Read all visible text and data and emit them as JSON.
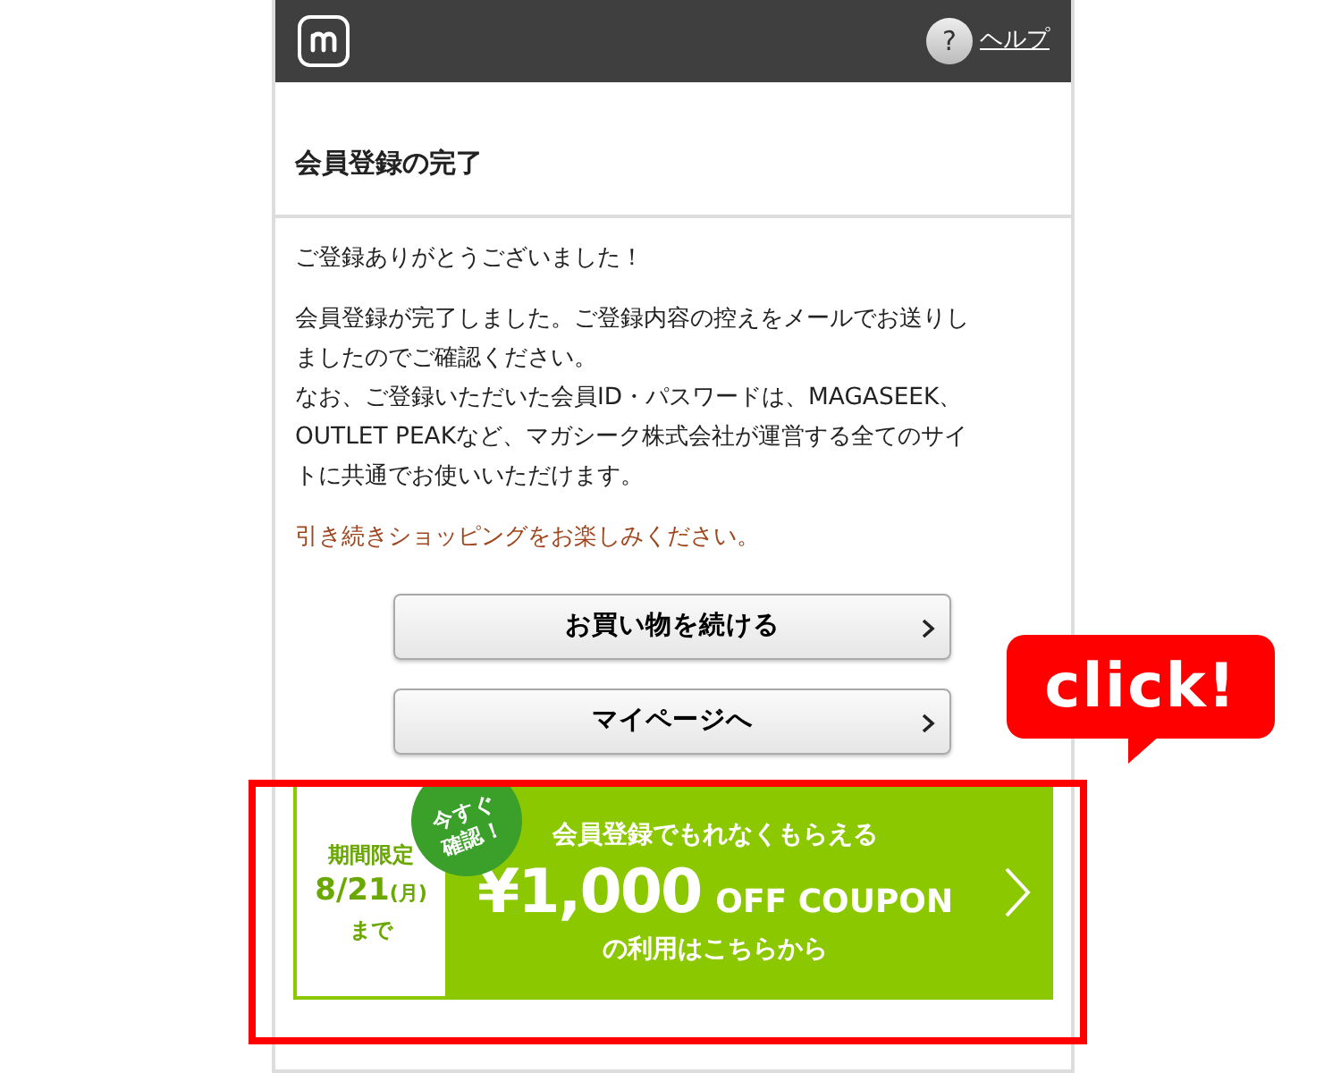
{
  "header": {
    "help_mark": "?",
    "help_label": "ヘルプ"
  },
  "title": "会員登録の完了",
  "thanks": "ご登録ありがとうございました！",
  "message_lines": [
    "会員登録が完了しました。ご登録内容の控えをメールでお送りし",
    "ましたのでご確認ください。",
    "なお、ご登録いただいた会員ID・パスワードは、MAGASEEK、",
    "OUTLET PEAKなど、マガシーク株式会社が運営する全てのサイ",
    "トに共通でお使いいただけます。"
  ],
  "note": "引き続きショッピングをお楽しみください。",
  "buttons": [
    {
      "label": "お買い物を続ける"
    },
    {
      "label": "マイページへ"
    }
  ],
  "banner": {
    "period_label": "期間限定",
    "date": "8/21",
    "weekday": "(月)",
    "until": "まで",
    "badge_lines": [
      "今すぐ",
      "確認！"
    ],
    "headline": "会員登録でもれなくもらえる",
    "amount": "¥1,000",
    "coupon": "OFF COUPON",
    "footer": "の利用はこちらから"
  },
  "annotation": {
    "callout": "click!"
  }
}
